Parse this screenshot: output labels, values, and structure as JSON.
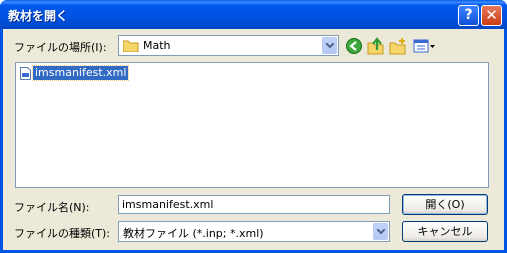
{
  "window": {
    "title": "教材を開く",
    "help": "?",
    "close": "✕"
  },
  "lookin": {
    "label": "ファイルの場所(I):",
    "value": "Math"
  },
  "files": [
    {
      "name": "imsmanifest.xml"
    }
  ],
  "filename": {
    "label": "ファイル名(N):",
    "value": "imsmanifest.xml"
  },
  "filetype": {
    "label": "ファイルの種類(T):",
    "value": "教材ファイル (*.inp; *.xml)"
  },
  "buttons": {
    "open": "開く(O)",
    "cancel": "キャンセル"
  },
  "colors": {
    "titlebar": "#0054e3",
    "selection": "#316ac5",
    "face": "#ece9d8"
  },
  "toolbar_icons": [
    "back-icon",
    "up-folder-icon",
    "new-folder-icon",
    "view-menu-icon"
  ]
}
